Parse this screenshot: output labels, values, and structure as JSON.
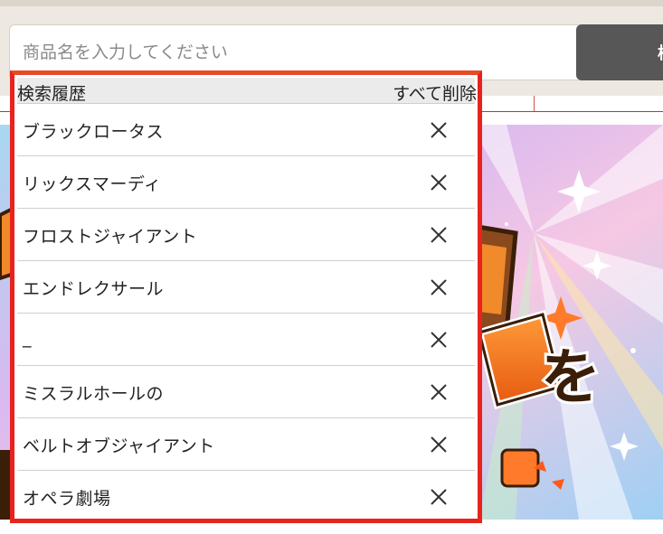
{
  "search": {
    "placeholder": "商品名を入力してください",
    "button_label": "検"
  },
  "history": {
    "title": "検索履歴",
    "clear_all_label": "すべて削除",
    "items": [
      {
        "label": "ブラックロータス"
      },
      {
        "label": "リックスマーディ"
      },
      {
        "label": "フロストジャイアント"
      },
      {
        "label": "エンドレクサール"
      },
      {
        "label": "_"
      },
      {
        "label": "ミスラルホールの"
      },
      {
        "label": "ベルトオブジャイアント"
      },
      {
        "label": "オペラ劇場"
      }
    ],
    "remove_icon": "close-icon"
  },
  "colors": {
    "highlight_border": "#e8231f",
    "search_button": "#575757",
    "topbar_bg": "#ede8e1"
  },
  "banner": {
    "visible_text": "を"
  }
}
